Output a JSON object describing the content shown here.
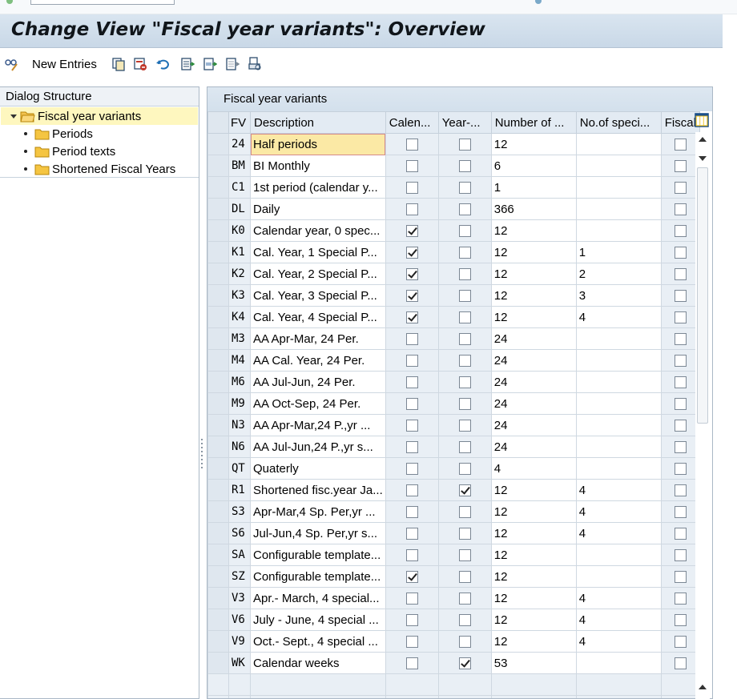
{
  "window": {
    "title": "Change View \"Fiscal year variants\": Overview"
  },
  "toolbar": {
    "new_entries_label": "New Entries",
    "icons": [
      "edit-glasses-icon",
      "copy-icon",
      "delete-icon",
      "undo-icon",
      "select-all-icon",
      "select-block-icon",
      "deselect-all-icon",
      "print-icon"
    ]
  },
  "dialog_structure": {
    "header": "Dialog Structure",
    "items": [
      {
        "label": "Fiscal year variants",
        "selected": true,
        "level": 0
      },
      {
        "label": "Periods",
        "selected": false,
        "level": 1
      },
      {
        "label": "Period texts",
        "selected": false,
        "level": 1
      },
      {
        "label": "Shortened Fiscal Years",
        "selected": false,
        "level": 1
      }
    ]
  },
  "table": {
    "title": "Fiscal year variants",
    "columns": [
      "FV",
      "Description",
      "Calen...",
      "Year-...",
      "Number of ...",
      "No.of speci...",
      "Fiscal"
    ],
    "rows": [
      {
        "fv": "24",
        "desc": "Half periods",
        "cal": false,
        "year": false,
        "num": "12",
        "spec": ""
      },
      {
        "fv": "BM",
        "desc": "BI Monthly",
        "cal": false,
        "year": false,
        "num": "6",
        "spec": ""
      },
      {
        "fv": "C1",
        "desc": "1st period (calendar y...",
        "cal": false,
        "year": false,
        "num": "1",
        "spec": ""
      },
      {
        "fv": "DL",
        "desc": "Daily",
        "cal": false,
        "year": false,
        "num": "366",
        "spec": ""
      },
      {
        "fv": "K0",
        "desc": "Calendar year, 0 spec...",
        "cal": true,
        "year": false,
        "num": "12",
        "spec": ""
      },
      {
        "fv": "K1",
        "desc": "Cal. Year, 1 Special P...",
        "cal": true,
        "year": false,
        "num": "12",
        "spec": "1"
      },
      {
        "fv": "K2",
        "desc": "Cal. Year, 2 Special P...",
        "cal": true,
        "year": false,
        "num": "12",
        "spec": "2"
      },
      {
        "fv": "K3",
        "desc": "Cal. Year, 3 Special P...",
        "cal": true,
        "year": false,
        "num": "12",
        "spec": "3"
      },
      {
        "fv": "K4",
        "desc": "Cal. Year, 4 Special P...",
        "cal": true,
        "year": false,
        "num": "12",
        "spec": "4"
      },
      {
        "fv": "M3",
        "desc": "AA Apr-Mar, 24 Per.",
        "cal": false,
        "year": false,
        "num": "24",
        "spec": ""
      },
      {
        "fv": "M4",
        "desc": "AA Cal. Year, 24 Per.",
        "cal": false,
        "year": false,
        "num": "24",
        "spec": ""
      },
      {
        "fv": "M6",
        "desc": "AA Jul-Jun, 24 Per.",
        "cal": false,
        "year": false,
        "num": "24",
        "spec": ""
      },
      {
        "fv": "M9",
        "desc": "AA Oct-Sep, 24 Per.",
        "cal": false,
        "year": false,
        "num": "24",
        "spec": ""
      },
      {
        "fv": "N3",
        "desc": "AA Apr-Mar,24 P.,yr ...",
        "cal": false,
        "year": false,
        "num": "24",
        "spec": ""
      },
      {
        "fv": "N6",
        "desc": "AA Jul-Jun,24 P.,yr s...",
        "cal": false,
        "year": false,
        "num": "24",
        "spec": ""
      },
      {
        "fv": "QT",
        "desc": "Quaterly",
        "cal": false,
        "year": false,
        "num": "4",
        "spec": ""
      },
      {
        "fv": "R1",
        "desc": "Shortened fisc.year Ja...",
        "cal": false,
        "year": true,
        "num": "12",
        "spec": "4"
      },
      {
        "fv": "S3",
        "desc": "Apr-Mar,4 Sp. Per,yr ...",
        "cal": false,
        "year": false,
        "num": "12",
        "spec": "4"
      },
      {
        "fv": "S6",
        "desc": "Jul-Jun,4 Sp. Per,yr s...",
        "cal": false,
        "year": false,
        "num": "12",
        "spec": "4"
      },
      {
        "fv": "SA",
        "desc": "Configurable template...",
        "cal": false,
        "year": false,
        "num": "12",
        "spec": ""
      },
      {
        "fv": "SZ",
        "desc": "Configurable template...",
        "cal": true,
        "year": false,
        "num": "12",
        "spec": ""
      },
      {
        "fv": "V3",
        "desc": "Apr.- March, 4 special...",
        "cal": false,
        "year": false,
        "num": "12",
        "spec": "4"
      },
      {
        "fv": "V6",
        "desc": "July - June, 4 special ...",
        "cal": false,
        "year": false,
        "num": "12",
        "spec": "4"
      },
      {
        "fv": "V9",
        "desc": "Oct.- Sept., 4 special ...",
        "cal": false,
        "year": false,
        "num": "12",
        "spec": "4"
      },
      {
        "fv": "WK",
        "desc": "Calendar weeks",
        "cal": false,
        "year": true,
        "num": "53",
        "spec": ""
      }
    ]
  },
  "colors": {
    "title_bg": "#d3e0ec",
    "selected_tree_bg": "#fef7bf",
    "focused_cell_bg": "#fbe9a5"
  }
}
